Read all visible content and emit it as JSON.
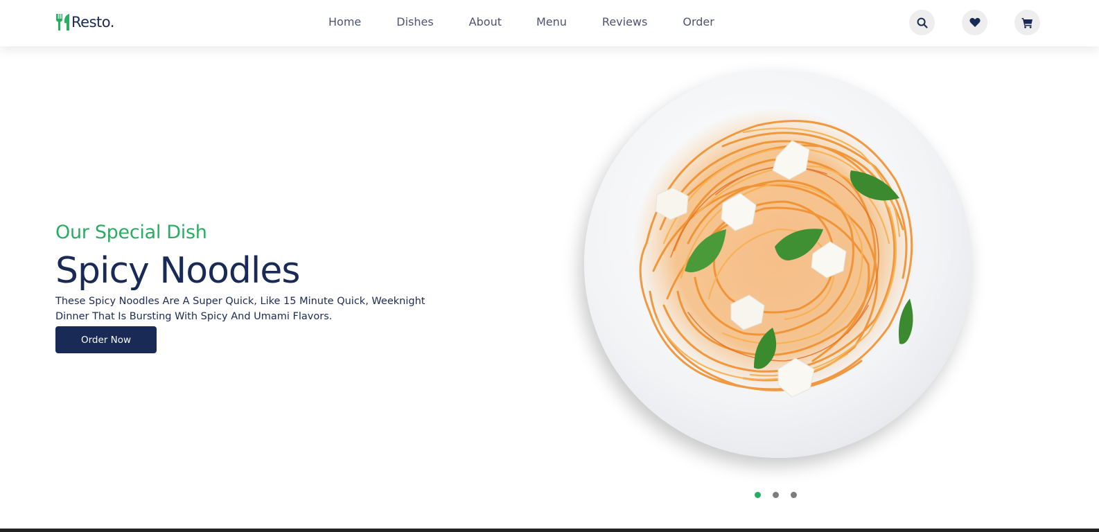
{
  "brand": {
    "name": "Resto.",
    "logo_icon": "utensils-icon",
    "accent_color": "#27ae60",
    "primary_color": "#192a56"
  },
  "nav": {
    "items": [
      "Home",
      "Dishes",
      "About",
      "Menu",
      "Reviews",
      "Order"
    ]
  },
  "header_icons": [
    "search-icon",
    "heart-icon",
    "cart-icon"
  ],
  "hero": {
    "subtitle": "Our Special Dish",
    "title": "Spicy Noodles",
    "description": "These Spicy Noodles Are A Super Quick, Like 15 Minute Quick, Weeknight Dinner That Is Bursting With Spicy And Umami Flavors.",
    "button_label": "Order Now",
    "image": "spaghetti-plate-image"
  },
  "slider": {
    "count": 3,
    "active_index": 0
  }
}
